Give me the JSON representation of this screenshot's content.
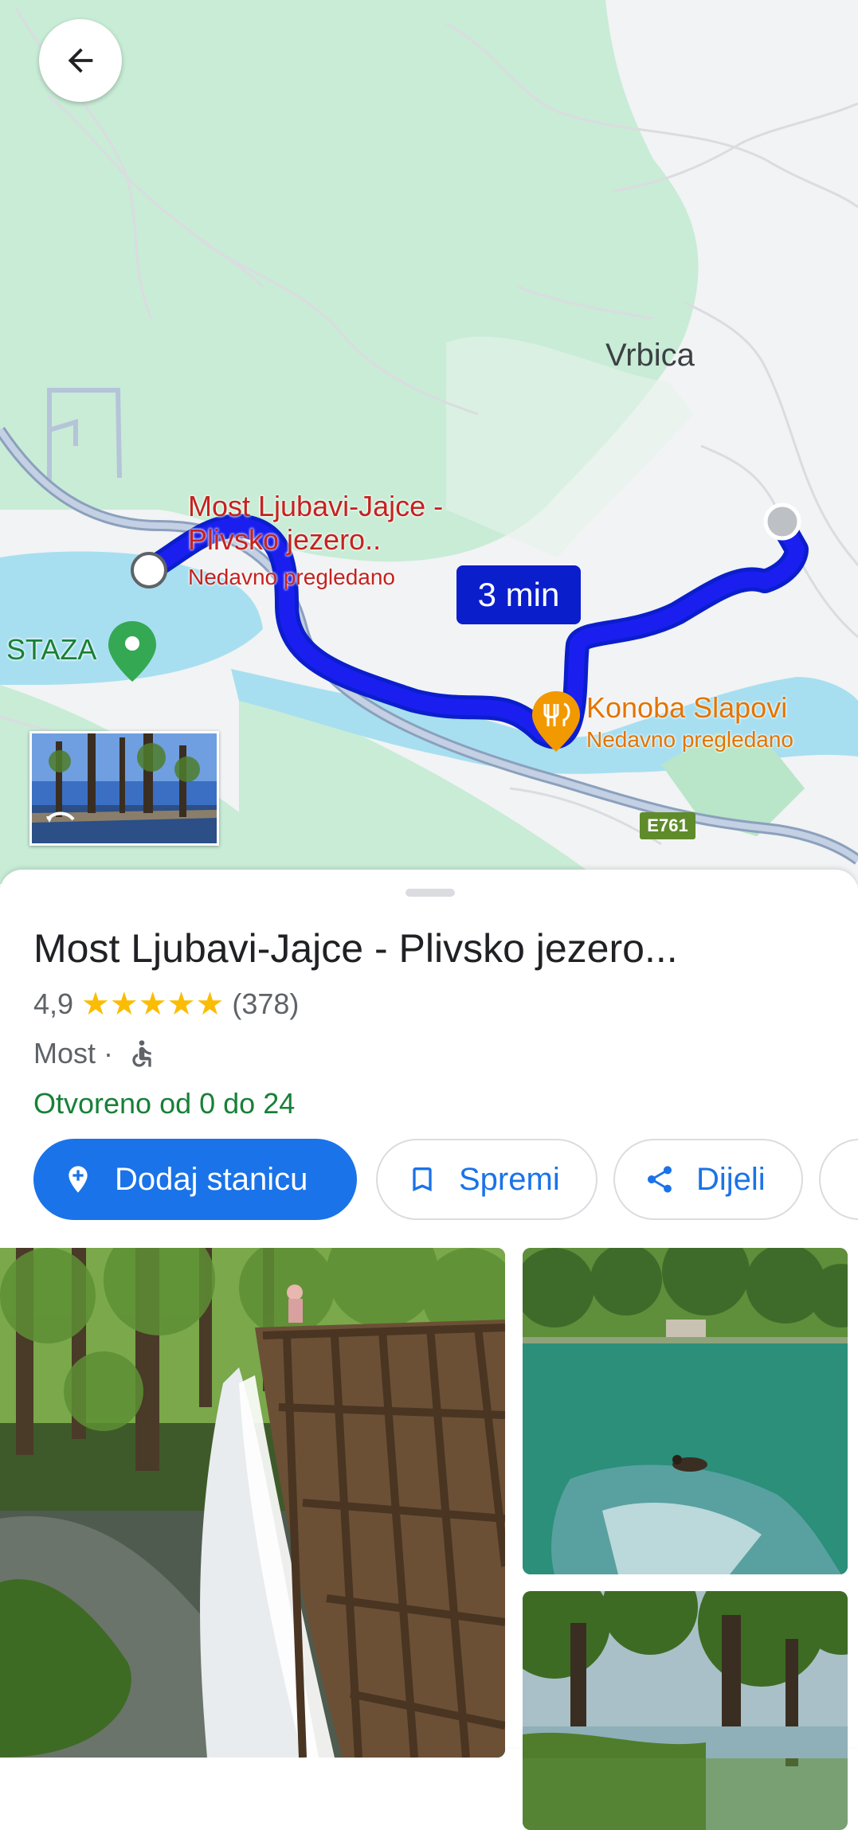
{
  "map": {
    "town_label": "Vrbica",
    "place_pin": {
      "name": "Most Ljubavi-Jajce - Plivsko jezero..",
      "status": "Nedavno pregledano"
    },
    "restaurant_pin": {
      "name": "Konoba Slapovi",
      "status": "Nedavno pregledano",
      "icon": "fork-knife-icon",
      "color": "#f29900"
    },
    "trail_pin": {
      "name": "STAZA",
      "color": "#34a853"
    },
    "route_time": "3 min",
    "route_color": "#1a1ff0",
    "road_label": "E761",
    "back_icon": "arrow-left-icon"
  },
  "place": {
    "title": "Most Ljubavi-Jajce - Plivsko jezero...",
    "rating": "4,9",
    "stars": 5,
    "review_count": "(378)",
    "category": "Most · ",
    "accessibility_icon": "wheelchair-icon",
    "hours": "Otvoreno od 0 do 24"
  },
  "actions": {
    "add_stop": "Dodaj stanicu",
    "save": "Spremi",
    "share": "Dijeli"
  },
  "colors": {
    "accent": "#1a73e8",
    "open_green": "#188038",
    "star": "#fbbc04"
  }
}
